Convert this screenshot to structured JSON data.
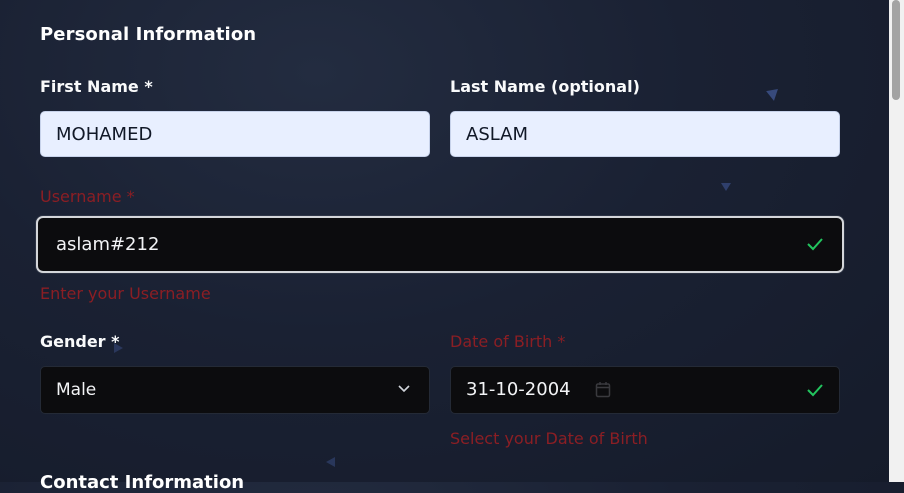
{
  "form": {
    "section_personal": "Personal Information",
    "section_contact": "Contact Information",
    "first_name": {
      "label": "First Name *",
      "value": "MOHAMED"
    },
    "last_name": {
      "label": "Last Name (optional)",
      "value": "ASLAM"
    },
    "username": {
      "label": "Username *",
      "value": "aslam#212",
      "helper": "Enter your Username",
      "valid_icon": "check-icon"
    },
    "gender": {
      "label": "Gender *",
      "value": "Male",
      "icon": "chevron-down-icon"
    },
    "dob": {
      "label": "Date of Birth *",
      "value": "31-10-2004",
      "helper": "Select your Date of Birth",
      "icons": [
        "calendar-icon",
        "check-icon"
      ]
    }
  },
  "colors": {
    "background": "#1a2133",
    "error_text": "#8b1e24",
    "valid": "#22c55e",
    "input_light_bg": "#e8efff",
    "input_dark_bg": "#0c0c0e"
  }
}
